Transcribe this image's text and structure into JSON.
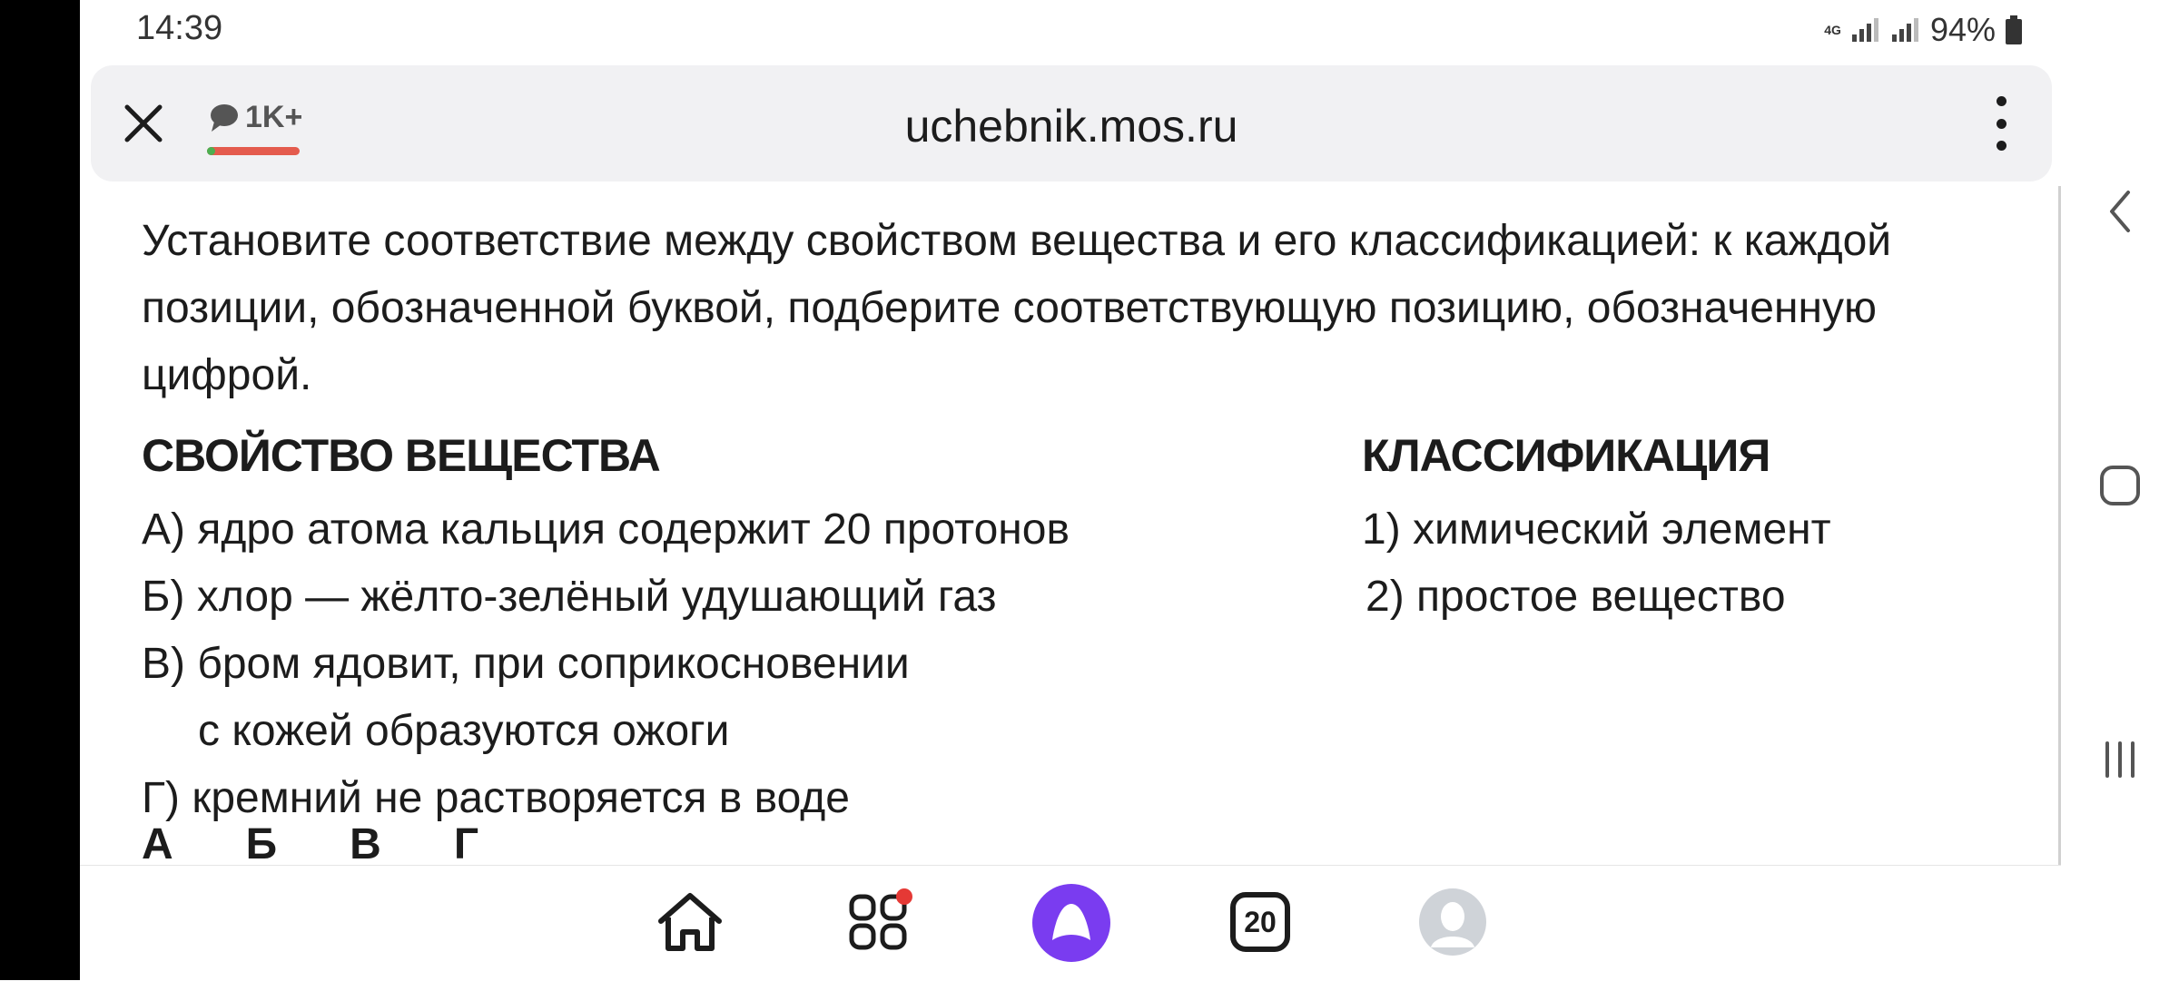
{
  "status": {
    "time": "14:39",
    "network": "4G",
    "battery": "94%"
  },
  "browser": {
    "url": "uchebnik.mos.ru",
    "comments_count": "1K+"
  },
  "task": {
    "text": "Установите соответствие между свойством вещества и его классификацией: к каждой позиции, обозначенной буквой, подберите соответствующую позицию, обозначенную цифрой.",
    "left_header": "СВОЙСТВО ВЕЩЕСТВА",
    "right_header": "КЛАССИФИКАЦИЯ",
    "properties": [
      "А) ядро атома кальция содержит 20 протонов",
      "Б) хлор — жёлто-зелёный удушающий газ",
      "В) бром ядовит, при соприкосновении",
      "с кожей образуются ожоги",
      "Г) кремний не растворяется в воде"
    ],
    "classifications": [
      "1) химический элемент",
      "2) простое вещество"
    ],
    "answer_letters": [
      "А",
      "Б",
      "В",
      "Г"
    ]
  },
  "bottom_bar": {
    "tabs_count": "20"
  },
  "icons": {
    "close": "close-icon",
    "comment": "comment-icon",
    "menu": "more-vert-icon",
    "home": "home-icon",
    "services": "services-icon",
    "alice": "alice-icon",
    "tabs": "tabs-icon",
    "profile": "avatar-icon",
    "back": "back-icon",
    "home_nav": "home-nav-icon",
    "recents": "recents-icon"
  },
  "colors": {
    "alice": "#7a3cf0",
    "notification_dot": "#e53935",
    "comments_line": "#e45b4d"
  }
}
